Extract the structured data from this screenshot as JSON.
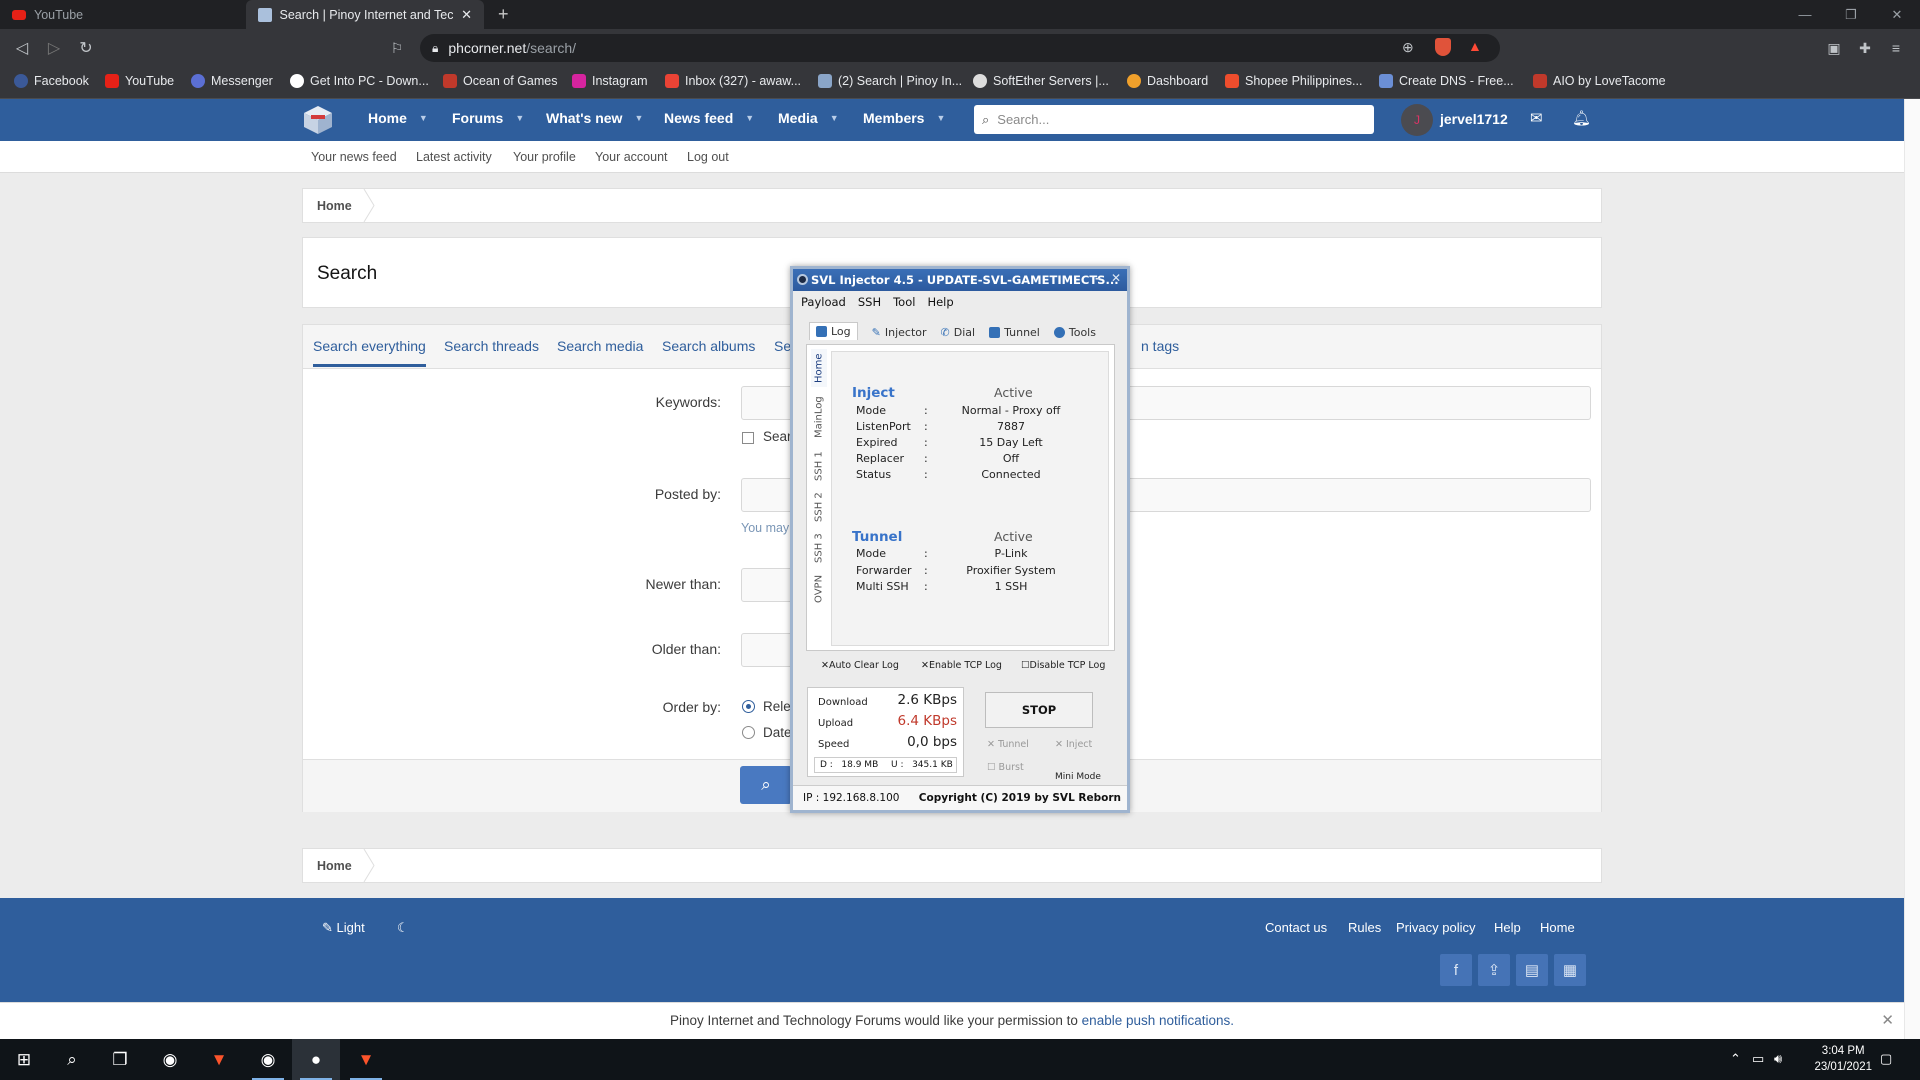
{
  "browser": {
    "tabs": [
      {
        "title": "YouTube",
        "active": false
      },
      {
        "title": "Search | Pinoy Internet and Techn",
        "active": true
      }
    ],
    "new_tab": "+",
    "url_host": "phcorner.net",
    "url_path": "/search/",
    "bookmarks": [
      {
        "label": "Facebook",
        "color": "#3b5998"
      },
      {
        "label": "YouTube",
        "color": "#e62117"
      },
      {
        "label": "Messenger",
        "color": "#5b6fd4"
      },
      {
        "label": "Get Into PC - Down...",
        "color": "#ffffff"
      },
      {
        "label": "Ocean of Games",
        "color": "#c0392b"
      },
      {
        "label": "Instagram",
        "color": "#d6249f"
      },
      {
        "label": "Inbox (327) - awaw...",
        "color": "#ea4335"
      },
      {
        "label": "(2) Search | Pinoy In...",
        "color": "#8aa5c8"
      },
      {
        "label": "SoftEther Servers |...",
        "color": "#dddddd"
      },
      {
        "label": "Dashboard",
        "color": "#f0a02b"
      },
      {
        "label": "Shopee Philippines...",
        "color": "#ee4d2d"
      },
      {
        "label": "Create DNS - Free...",
        "color": "#6b8fd6"
      },
      {
        "label": "AIO by LoveTacome",
        "color": "#c0392b"
      }
    ]
  },
  "site": {
    "nav": [
      "Home",
      "Forums",
      "What's new",
      "News feed",
      "Media",
      "Members"
    ],
    "search_placeholder": "Search...",
    "username": "jervel1712",
    "avatar_initial": "J",
    "subnav": [
      "Your news feed",
      "Latest activity",
      "Your profile",
      "Your account",
      "Log out"
    ],
    "breadcrumb": "Home",
    "page_title": "Search",
    "search_tabs": [
      "Search everything",
      "Search threads",
      "Search media",
      "Search albums",
      "Se",
      "n tags"
    ],
    "form": {
      "keywords_label": "Keywords:",
      "search_titles_partial": "Sear",
      "posted_by_label": "Posted by:",
      "posted_by_hint": "You may",
      "newer_than_label": "Newer than:",
      "older_than_label": "Older than:",
      "order_by_label": "Order by:",
      "order_options": [
        "Rele",
        "Date"
      ]
    },
    "footer": {
      "style_label": "Light",
      "links": [
        "Contact us",
        "Rules",
        "Privacy policy",
        "Help",
        "Home"
      ]
    },
    "push_notice": "Pinoy Internet and Technology Forums would like your permission to ",
    "push_link": "enable push notifications."
  },
  "svl": {
    "title": "SVL Injector 4.5 - UPDATE-SVL-GAMETIMECTS...",
    "menu": [
      "Payload",
      "SSH",
      "Tool",
      "Help"
    ],
    "tabs": [
      "Log",
      "Injector",
      "Dial",
      "Tunnel",
      "Tools"
    ],
    "vtabs": [
      "Home",
      "MainLog",
      "SSH 1",
      "SSH 2",
      "SSH 3",
      "OVPN"
    ],
    "inject": {
      "title": "Inject",
      "state": "Active",
      "rows": [
        {
          "k": "Mode",
          "v": "Normal - Proxy off"
        },
        {
          "k": "ListenPort",
          "v": "7887"
        },
        {
          "k": "Expired",
          "v": "15 Day Left"
        },
        {
          "k": "Replacer",
          "v": "Off"
        },
        {
          "k": "Status",
          "v": "Connected"
        }
      ]
    },
    "tunnel": {
      "title": "Tunnel",
      "state": "Active",
      "rows": [
        {
          "k": "Mode",
          "v": "P-Link"
        },
        {
          "k": "Forwarder",
          "v": "Proxifier System"
        },
        {
          "k": "Multi SSH",
          "v": "1 SSH"
        }
      ]
    },
    "checks": [
      "Auto Clear Log",
      "Enable TCP Log",
      "Disable TCP Log"
    ],
    "stats": {
      "download_label": "Download",
      "download": "2.6 KBps",
      "upload_label": "Upload",
      "upload": "6.4 KBps",
      "speed_label": "Speed",
      "speed": "0,0 bps",
      "d_total": "D :   18.9 MB",
      "u_total": "U :   345.1 KB"
    },
    "stop": "STOP",
    "opts": [
      "Tunnel",
      "Inject",
      "Burst"
    ],
    "mini_mode": "Mini Mode",
    "ip": "IP : 192.168.8.100",
    "copyright": "Copyright (C) 2019 by SVL Reborn"
  },
  "taskbar": {
    "time": "3:04 PM",
    "date": "23/01/2021"
  }
}
